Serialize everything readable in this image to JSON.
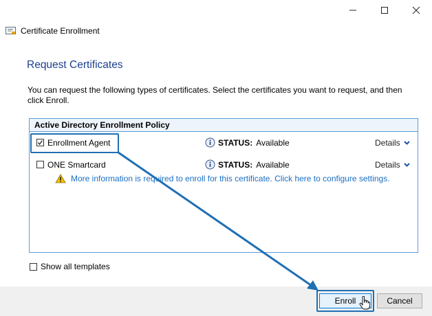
{
  "window": {
    "title": "Certificate Enrollment",
    "controls": {
      "minimize": "–",
      "maximize": "☐",
      "close": "✕"
    }
  },
  "page": {
    "heading": "Request Certificates",
    "description": "You can request the following types of certificates. Select the certificates you want to request, and then click Enroll."
  },
  "policy": {
    "header": "Active Directory Enrollment Policy",
    "items": [
      {
        "name": "Enrollment Agent",
        "checked": true,
        "status_label": "STATUS:",
        "status_value": "Available",
        "details": "Details"
      },
      {
        "name": "ONE Smartcard",
        "checked": false,
        "status_label": "STATUS:",
        "status_value": "Available",
        "details": "Details",
        "warning": "More information is required to enroll for this certificate. Click here to configure settings."
      }
    ]
  },
  "options": {
    "show_all_templates": "Show all templates",
    "show_all_checked": false
  },
  "buttons": {
    "enroll": "Enroll",
    "cancel": "Cancel"
  },
  "colors": {
    "accent": "#1f6fb3",
    "heading": "#1b3f8f",
    "link": "#1a6fc4",
    "warning": "#f2c200"
  },
  "icons": {
    "title": "certificate-icon",
    "info": "info-icon",
    "warning": "warning-icon",
    "details": "chevron-down-icon",
    "cursor": "hand-cursor-icon"
  }
}
